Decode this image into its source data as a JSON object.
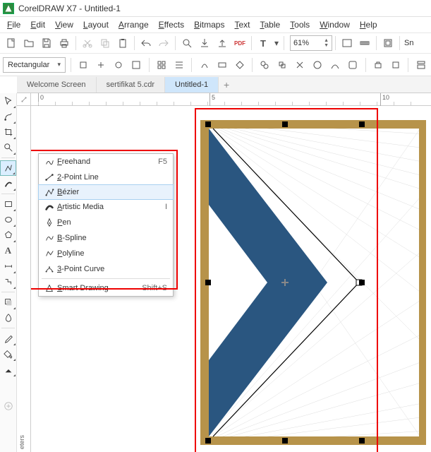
{
  "app": {
    "title": "CorelDRAW X7 - Untitled-1"
  },
  "menus": [
    {
      "label": "File",
      "u": "F"
    },
    {
      "label": "Edit",
      "u": "E"
    },
    {
      "label": "View",
      "u": "V"
    },
    {
      "label": "Layout",
      "u": "L"
    },
    {
      "label": "Arrange",
      "u": "A"
    },
    {
      "label": "Effects",
      "u": "E"
    },
    {
      "label": "Bitmaps",
      "u": "B"
    },
    {
      "label": "Text",
      "u": "T"
    },
    {
      "label": "Table",
      "u": "T"
    },
    {
      "label": "Tools",
      "u": "T"
    },
    {
      "label": "Window",
      "u": "W"
    },
    {
      "label": "Help",
      "u": "H"
    }
  ],
  "zoom": {
    "value": "61%"
  },
  "shape": {
    "value": "Rectangular"
  },
  "snap_label": "Sn",
  "tabs": [
    {
      "label": "Welcome Screen",
      "active": false
    },
    {
      "label": "sertifikat 5.cdr",
      "active": false
    },
    {
      "label": "Untitled-1",
      "active": true
    }
  ],
  "ruler": {
    "labels": [
      "0",
      "5",
      "10"
    ]
  },
  "flyout": {
    "items": [
      {
        "icon": "freehand",
        "label": "Freehand",
        "u": "F",
        "key": "F5",
        "sel": false
      },
      {
        "icon": "2point",
        "label": "2-Point Line",
        "u": "2",
        "key": "",
        "sel": false
      },
      {
        "icon": "bezier",
        "label": "Bézier",
        "u": "B",
        "key": "",
        "sel": true
      },
      {
        "icon": "artistic",
        "label": "Artistic Media",
        "u": "A",
        "key": "I",
        "sel": false
      },
      {
        "icon": "pen",
        "label": "Pen",
        "u": "P",
        "key": "",
        "sel": false
      },
      {
        "icon": "bspline",
        "label": "B-Spline",
        "u": "B",
        "key": "",
        "sel": false
      },
      {
        "icon": "polyline",
        "label": "Polyline",
        "u": "P",
        "key": "",
        "sel": false
      },
      {
        "icon": "3point",
        "label": "3-Point Curve",
        "u": "3",
        "key": "",
        "sel": false
      },
      {
        "icon": "smart",
        "label": "Smart Drawing",
        "u": "S",
        "key": "Shift+S",
        "sel": false,
        "sep_before": true
      }
    ]
  },
  "status": {
    "units": "eters"
  }
}
